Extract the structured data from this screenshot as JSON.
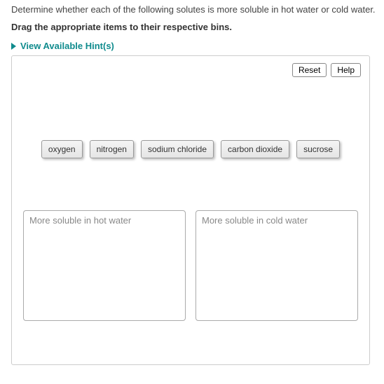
{
  "question": "Determine whether each of the following solutes is more soluble in hot water or cold water.",
  "instruction": "Drag the appropriate items to their respective bins.",
  "hints_label": "View Available Hint(s)",
  "controls": {
    "reset": "Reset",
    "help": "Help"
  },
  "chips": [
    {
      "label": "oxygen"
    },
    {
      "label": "nitrogen"
    },
    {
      "label": "sodium chloride"
    },
    {
      "label": "carbon dioxide"
    },
    {
      "label": "sucrose"
    }
  ],
  "bins": [
    {
      "title": "More soluble in hot water"
    },
    {
      "title": "More soluble in cold water"
    }
  ]
}
